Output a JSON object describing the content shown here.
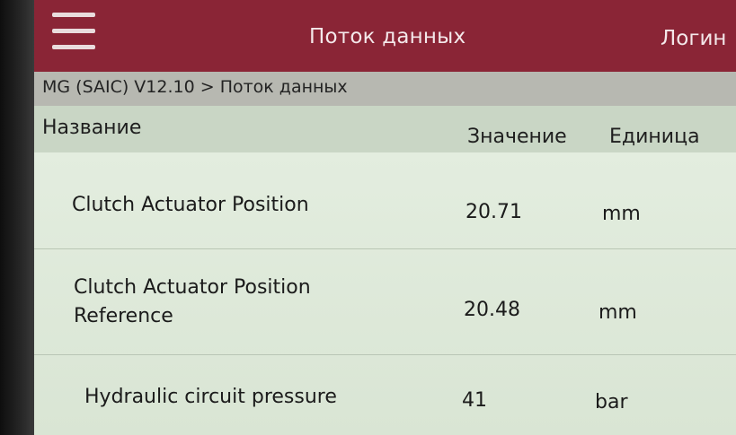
{
  "app_bar": {
    "title": "Поток данных",
    "login_label": "Логин"
  },
  "breadcrumb": "MG (SAIC) V12.10 > Поток данных",
  "table": {
    "headers": {
      "name": "Название",
      "value": "Значение",
      "unit": "Единица"
    },
    "rows": [
      {
        "name": "Clutch Actuator Position",
        "value": "20.71",
        "unit": "mm"
      },
      {
        "name_line1": "Clutch Actuator Position",
        "name_line2": "Reference",
        "value": "20.48",
        "unit": "mm"
      },
      {
        "name": "Hydraulic circuit pressure",
        "value": "41",
        "unit": "bar"
      }
    ]
  },
  "colors": {
    "app_bar": "#8a2536",
    "breadcrumb_bar": "#b7b8b1",
    "header_row": "#c9d6c5",
    "rows_bg": "#dfe9da"
  },
  "icons": {
    "menu": "hamburger-menu-icon"
  }
}
